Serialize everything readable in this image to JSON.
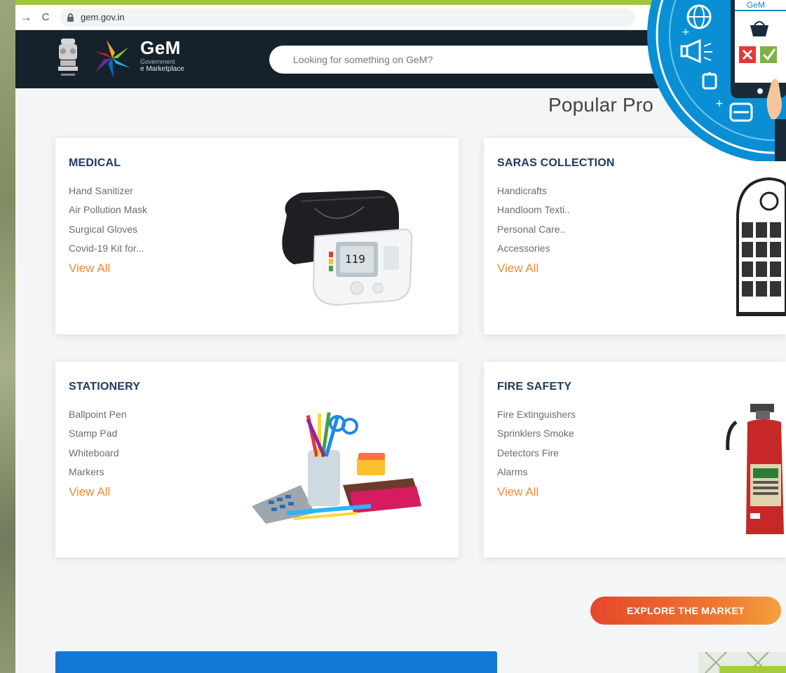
{
  "browser": {
    "url": "gem.gov.in",
    "back_glyph": "→",
    "reload_glyph": "C"
  },
  "header": {
    "logo_main": "GeM",
    "logo_sub1": "Government",
    "logo_sub2": "e Marketplace",
    "search_placeholder": "Looking for something on GeM?"
  },
  "section_title": "Popular Pro",
  "overlay": {
    "label": "GeM"
  },
  "cards": [
    {
      "title": "MEDICAL",
      "items": [
        "Hand Sanitizer",
        "Air Pollution Mask",
        "Surgical Gloves",
        "Covid-19 Kit for..."
      ],
      "view_all": "View All",
      "image": "blood-pressure-monitor"
    },
    {
      "title": "SARAS COLLECTION",
      "items": [
        "Handicrafts",
        "Handloom Texti..",
        "Personal Care..",
        "Accessories"
      ],
      "view_all": "View All",
      "image": "ornamental-lantern"
    },
    {
      "title": "STATIONERY",
      "items": [
        "Ballpoint Pen",
        "Stamp Pad",
        "Whiteboard",
        "Markers"
      ],
      "view_all": "View All",
      "image": "stationery-set"
    },
    {
      "title": "FIRE SAFETY",
      "items": [
        "Fire Extinguishers",
        "Sprinklers Smoke",
        "Detectors Fire",
        "Alarms"
      ],
      "view_all": "View All",
      "image": "fire-extinguisher"
    }
  ],
  "explore_button": "EXPLORE THE MARKET",
  "colors": {
    "header_bg": "#15222b",
    "accent_orange": "#f08a36",
    "title_navy": "#1e3b62",
    "banner_blue": "#1178d3",
    "top_green": "#9ec63c"
  }
}
